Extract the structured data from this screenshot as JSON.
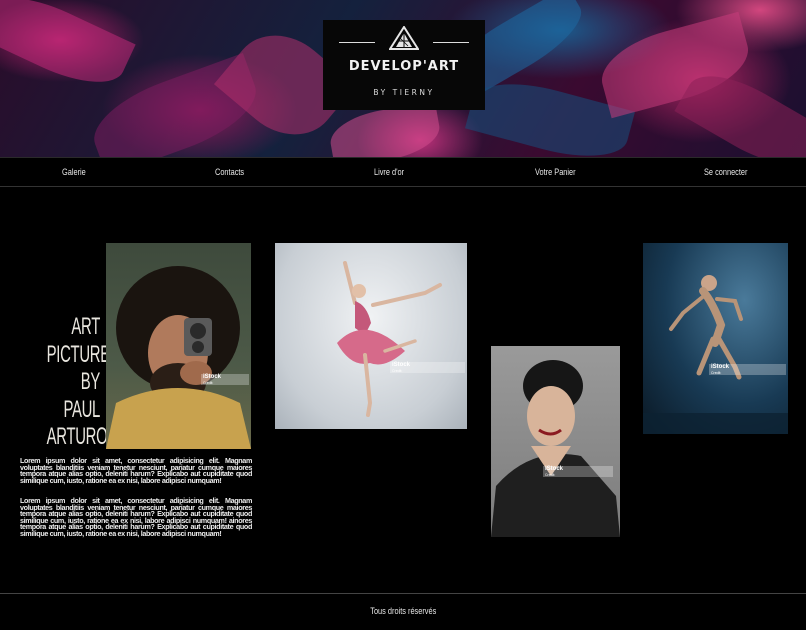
{
  "brand": {
    "title": "DEVELOP'ART",
    "subtitle": "BY TIERNY"
  },
  "nav": {
    "items": [
      {
        "label": "Galerie"
      },
      {
        "label": "Contacts"
      },
      {
        "label": "Livre d'or"
      },
      {
        "label": "Votre Panier"
      },
      {
        "label": "Se connecter"
      }
    ]
  },
  "intro": {
    "title_lines": [
      "ART",
      "PICTURES",
      "BY",
      "PAUL",
      "ARTURO"
    ],
    "paragraph_1": "Lorem ipsum dolor sit amet, consectetur adipisicing elit. Magnam voluptates blanditiis veniam tenetur nesciunt, pariatur cumque maiores tempora atque alias optio, deleniti harum? Explicabo aut cupiditate quod similique cum, iusto, ratione ea ex nisi, labore adipisci numquam!",
    "paragraph_2": "Lorem ipsum dolor sit amet, consectetur adipisicing elit. Magnam voluptates blanditiis veniam tenetur nesciunt, pariatur cumque maiores tempora atque alias optio, deleniti harum? Explicabo aut cupiditate quod similique cum, iusto, ratione ea ex nisi, labore adipisci numquam! ainores tempora atque alias optio, deleniti harum? Explicabo aut cupiditate quod similique cum, iusto, ratione ea ex nisi, labore adipisci numquam!"
  },
  "gallery": {
    "watermark": "iStock",
    "watermark_credit": "Credit: ",
    "photos": [
      {
        "name": "man-with-camera"
      },
      {
        "name": "ballerina"
      },
      {
        "name": "asian-woman-portrait"
      },
      {
        "name": "dancer-in-rain"
      }
    ]
  },
  "footer": {
    "text": "Tous droits réservés"
  },
  "colors": {
    "background": "#000000",
    "text": "#e8e8e8",
    "hero_magenta": "#b0206a",
    "hero_blue": "#1c5a8c"
  }
}
